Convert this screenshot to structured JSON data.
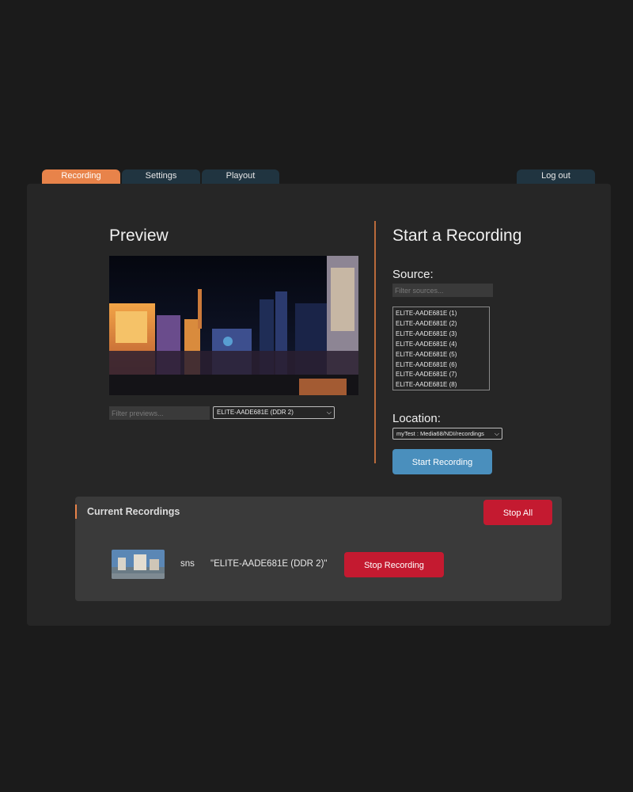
{
  "tabs": {
    "recording": "Recording",
    "settings": "Settings",
    "playout": "Playout",
    "logout": "Log out"
  },
  "preview": {
    "title": "Preview",
    "filter_placeholder": "Filter previews...",
    "selected_source": "ELITE-AADE681E (DDR 2)"
  },
  "start": {
    "title": "Start a Recording",
    "source_label": "Source:",
    "filter_placeholder": "Filter sources...",
    "sources": [
      "ELITE-AADE681E (1)",
      "ELITE-AADE681E (2)",
      "ELITE-AADE681E (3)",
      "ELITE-AADE681E (4)",
      "ELITE-AADE681E (5)",
      "ELITE-AADE681E (6)",
      "ELITE-AADE681E (7)",
      "ELITE-AADE681E (8)"
    ],
    "location_label": "Location:",
    "location_value": "myTest : Media68/NDI/recordings",
    "button_label": "Start Recording"
  },
  "current": {
    "title": "Current Recordings",
    "stop_all_label": "Stop All",
    "recordings": [
      {
        "name": "sns",
        "source": "\"ELITE-AADE681E (DDR 2)\"",
        "stop_label": "Stop Recording"
      }
    ]
  },
  "colors": {
    "accent": "#e8834a",
    "primary_button": "#4a8fbd",
    "danger_button": "#c41a30",
    "tab_inactive": "#203440"
  },
  "icons": {
    "dropdown": "chevron-down-icon"
  }
}
